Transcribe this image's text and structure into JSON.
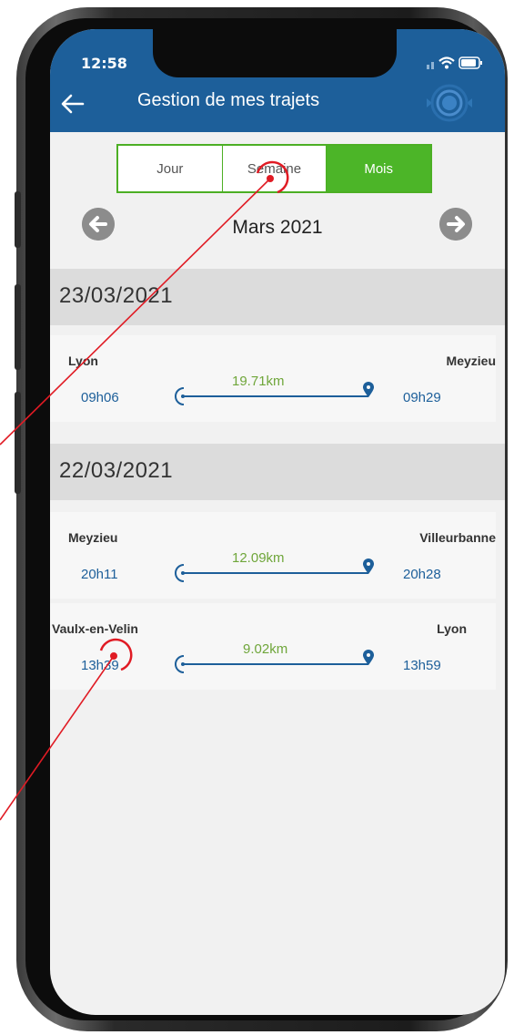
{
  "status_bar": {
    "time": "12:58"
  },
  "header": {
    "title": "Gestion de mes trajets"
  },
  "tabs": [
    {
      "label": "Jour",
      "active": false
    },
    {
      "label": "Semaine",
      "active": false
    },
    {
      "label": "Mois",
      "active": true
    }
  ],
  "month": {
    "label": "Mars 2021"
  },
  "days": [
    {
      "date": "23/03/2021",
      "trips": [
        {
          "from": "Lyon",
          "to": "Meyzieu",
          "start": "09h06",
          "end": "09h29",
          "distance": "19.71km"
        }
      ]
    },
    {
      "date": "22/03/2021",
      "trips": [
        {
          "from": "Meyzieu",
          "to": "Villeurbanne",
          "start": "20h11",
          "end": "20h28",
          "distance": "12.09km"
        },
        {
          "from": "Vaulx-en-Velin",
          "to": "Lyon",
          "start": "13h39",
          "end": "13h59",
          "distance": "9.02km"
        }
      ]
    }
  ],
  "colors": {
    "header": "#1d5f9a",
    "accent": "#4cb528",
    "distance": "#6fa63a",
    "time": "#1d5f9a",
    "annotation": "#e01b24"
  },
  "icons": [
    "back-arrow-icon",
    "sonar-icon",
    "prev-arrow-icon",
    "next-arrow-icon",
    "origin-marker-icon",
    "destination-pin-icon",
    "signal-icon",
    "wifi-icon",
    "battery-icon"
  ]
}
